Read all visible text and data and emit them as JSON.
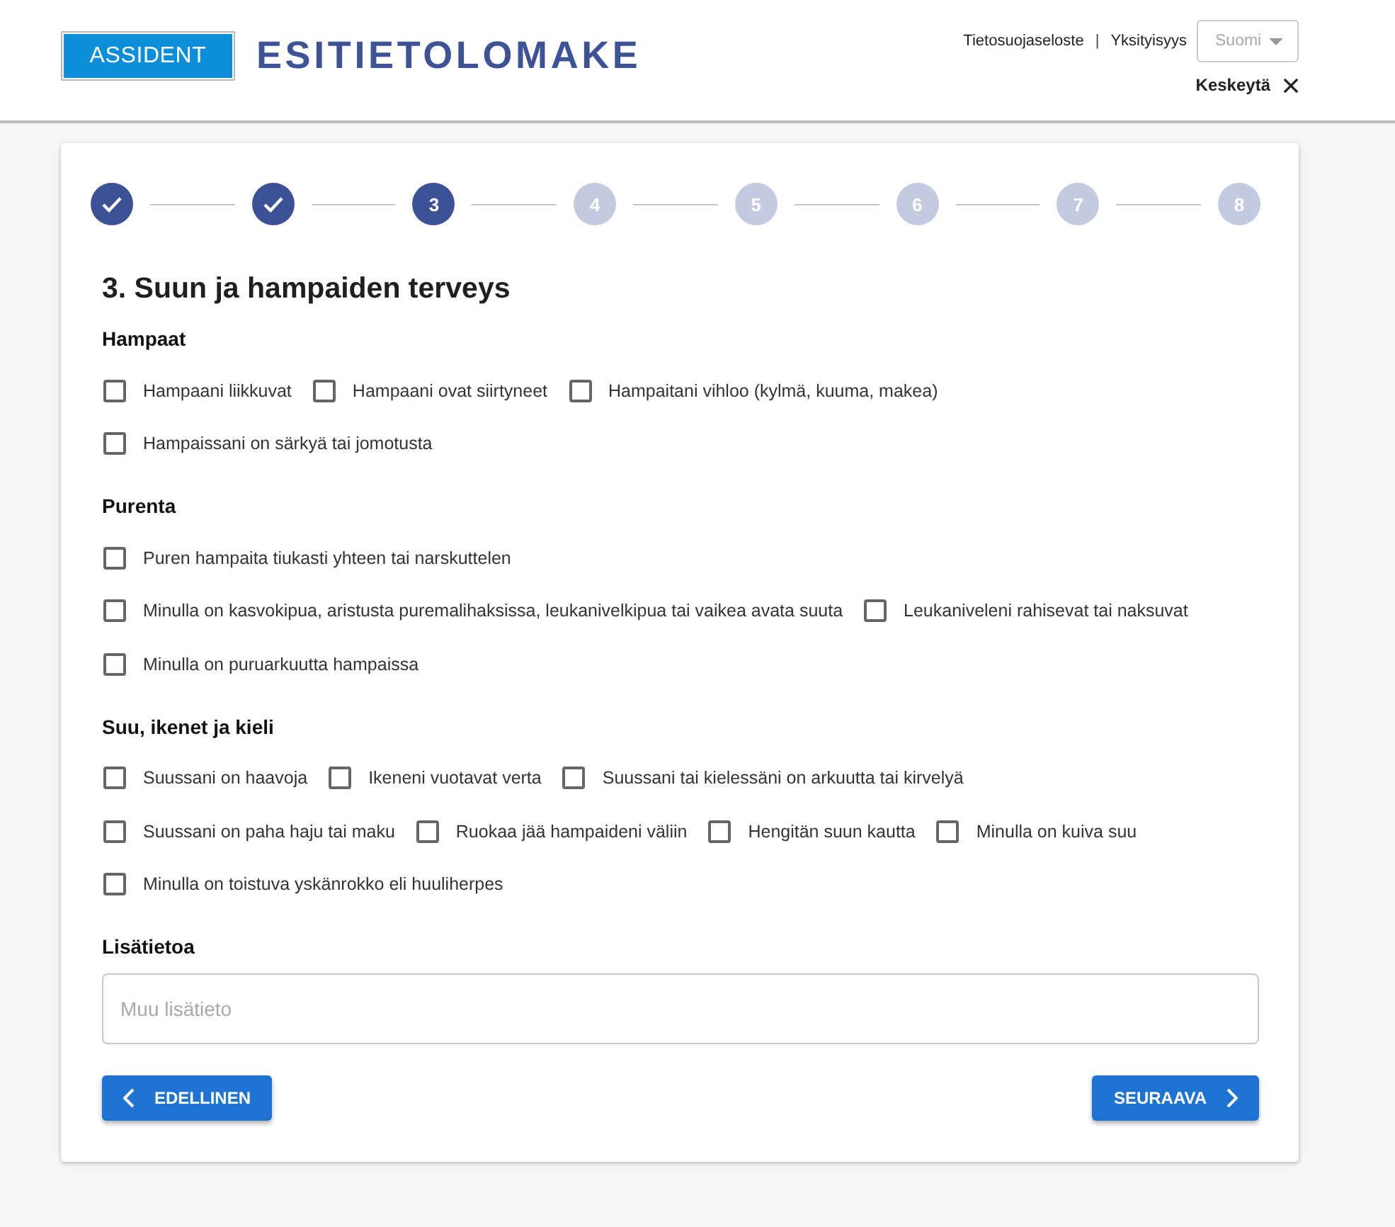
{
  "header": {
    "logo": "ASSIDENT",
    "title": "ESITIETOLOMAKE",
    "links": [
      {
        "label": "Tietosuojaseloste"
      },
      {
        "label": "Yksityisyys"
      }
    ],
    "separator": "|",
    "language": {
      "value": "Suomi",
      "disabled": true
    },
    "cancel": {
      "label": "Keskeytä"
    }
  },
  "stepper": {
    "steps": [
      {
        "kind": "done"
      },
      {
        "kind": "done"
      },
      {
        "kind": "current",
        "number": "3"
      },
      {
        "kind": "upcoming",
        "number": "4"
      },
      {
        "kind": "upcoming",
        "number": "5"
      },
      {
        "kind": "upcoming",
        "number": "6"
      },
      {
        "kind": "upcoming",
        "number": "7"
      },
      {
        "kind": "upcoming",
        "number": "8"
      }
    ]
  },
  "form": {
    "title": "3. Suun ja hampaiden terveys",
    "sections": [
      {
        "title": "Hampaat",
        "rows": [
          [
            {
              "label": "Hampaani liikkuvat",
              "checked": false
            },
            {
              "label": "Hampaani ovat siirtyneet",
              "checked": false
            },
            {
              "label": "Hampaitani vihloo (kylmä, kuuma, makea)",
              "checked": false
            }
          ],
          [
            {
              "label": "Hampaissani on särkyä tai jomotusta",
              "checked": false
            }
          ]
        ]
      },
      {
        "title": "Purenta",
        "rows": [
          [
            {
              "label": "Puren hampaita tiukasti yhteen tai narskuttelen",
              "checked": false
            }
          ],
          [
            {
              "label": "Minulla on kasvokipua, aristusta puremalihaksissa, leukanivelkipua tai vaikea avata suuta",
              "checked": false
            },
            {
              "label": "Leukaniveleni rahisevat tai naksuvat",
              "checked": false
            }
          ],
          [
            {
              "label": "Minulla on puruarkuutta hampaissa",
              "checked": false
            }
          ]
        ]
      },
      {
        "title": "Suu, ikenet ja kieli",
        "rows": [
          [
            {
              "label": "Suussani on haavoja",
              "checked": false
            },
            {
              "label": "Ikeneni vuotavat verta",
              "checked": false
            },
            {
              "label": "Suussani tai kielessäni on arkuutta tai kirvelyä",
              "checked": false
            }
          ],
          [
            {
              "label": "Suussani on paha haju tai maku",
              "checked": false
            },
            {
              "label": "Ruokaa jää hampaideni väliin",
              "checked": false
            },
            {
              "label": "Hengitän suun kautta",
              "checked": false
            },
            {
              "label": "Minulla on kuiva suu",
              "checked": false
            }
          ],
          [
            {
              "label": "Minulla on toistuva yskänrokko eli huuliherpes",
              "checked": false
            }
          ]
        ]
      }
    ],
    "notes": {
      "label": "Lisätietoa",
      "placeholder": "Muu lisätieto"
    }
  },
  "buttons": {
    "previous": "EDELLINEN",
    "next": "SEURAAVA"
  }
}
